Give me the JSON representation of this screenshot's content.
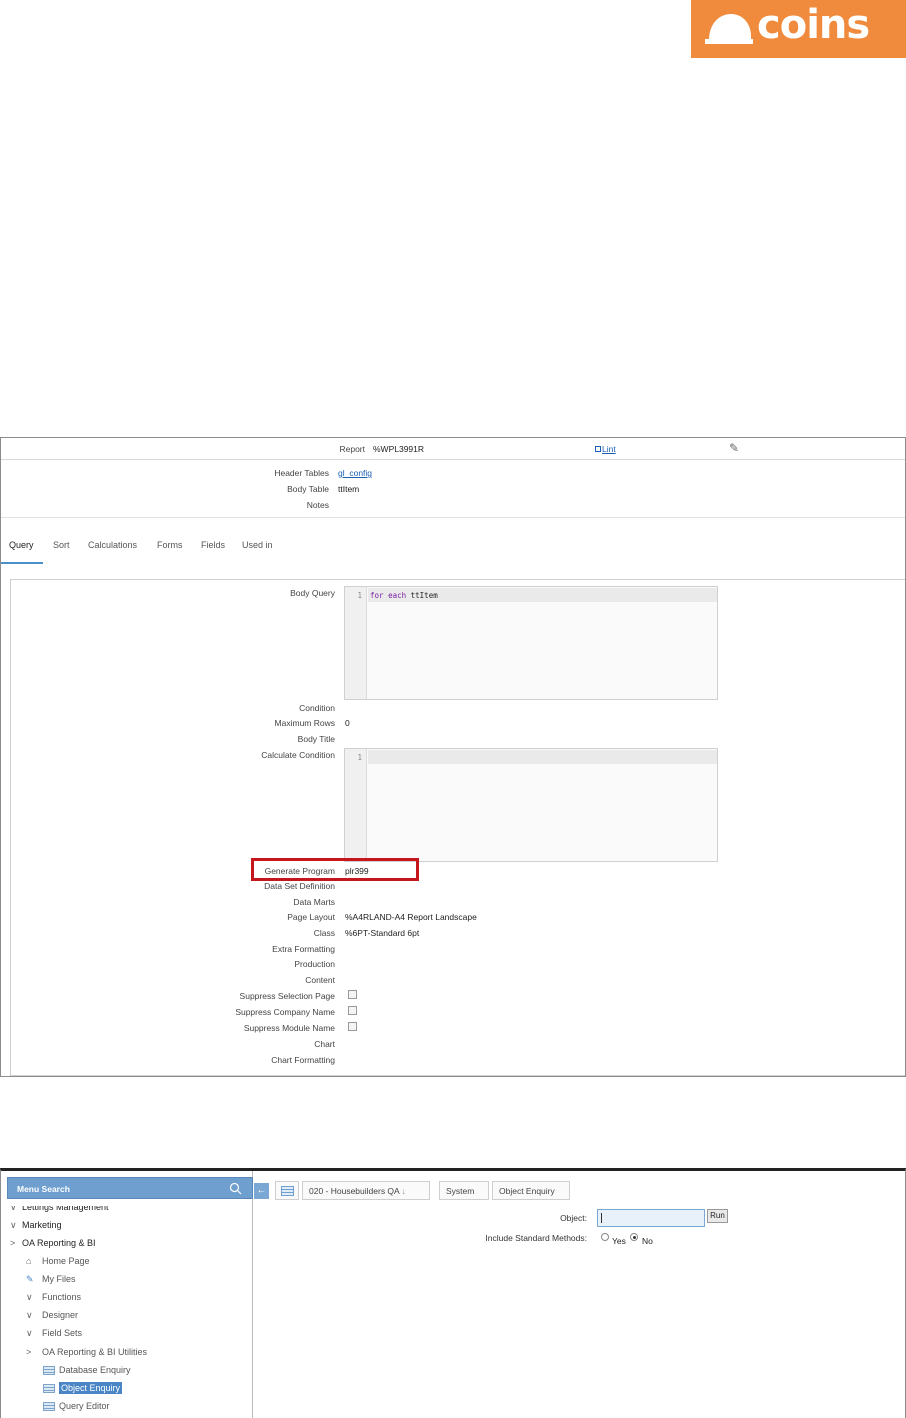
{
  "logo": {
    "text": "coins",
    "color": "#f08a3c"
  },
  "report": {
    "report_label": "Report",
    "report_value": "%WPL3991R",
    "lint_label": "Lint",
    "edit_icon": "pencil-icon",
    "fields": {
      "header_tables_label": "Header Tables",
      "header_tables_value": "gl_config",
      "body_table_label": "Body Table",
      "body_table_value": "ttItem",
      "notes_label": "Notes"
    },
    "tabs": [
      "Query",
      "Sort",
      "Calculations",
      "Forms",
      "Fields",
      "Used in"
    ],
    "active_tab": "Query",
    "query": {
      "body_query_label": "Body Query",
      "body_query_line_no": "1",
      "body_query_kw1": "for",
      "body_query_kw2": "each",
      "body_query_rest": "ttItem",
      "condition_label": "Condition",
      "max_rows_label": "Maximum Rows",
      "max_rows_value": "0",
      "body_title_label": "Body Title",
      "calc_condition_label": "Calculate Condition",
      "calc_condition_line_no": "1",
      "generate_program_label": "Generate Program",
      "generate_program_value": "plr399",
      "data_set_definition_label": "Data Set Definition",
      "data_marts_label": "Data Marts",
      "page_layout_label": "Page Layout",
      "page_layout_value": "%A4RLAND-A4 Report Landscape",
      "class_label": "Class",
      "class_value": "%6PT-Standard 6pt",
      "extra_formatting_label": "Extra Formatting",
      "production_label": "Production",
      "content_label": "Content",
      "suppress_selection_page_label": "Suppress Selection Page",
      "suppress_company_name_label": "Suppress Company Name",
      "suppress_module_name_label": "Suppress Module Name",
      "chart_label": "Chart",
      "chart_formatting_label": "Chart Formatting"
    }
  },
  "enquiry": {
    "menu_search_label": "Menu Search",
    "sidebar": {
      "lettings": "Lettings Management",
      "marketing": "Marketing",
      "oa_reporting": "OA Reporting & BI",
      "home_page": "Home Page",
      "my_files": "My Files",
      "functions": "Functions",
      "designer": "Designer",
      "field_sets": "Field Sets",
      "oa_utils": "OA Reporting & BI Utilities",
      "database_enquiry": "Database Enquiry",
      "object_enquiry": "Object Enquiry",
      "query_editor": "Query Editor"
    },
    "breadcrumb": {
      "company": "020 - Housebuilders QA",
      "system": "System",
      "page": "Object Enquiry"
    },
    "form": {
      "object_label": "Object:",
      "object_value": "",
      "run_label": "Run",
      "include_methods_label": "Include Standard Methods:",
      "yes_label": "Yes",
      "no_label": "No",
      "selected": "No"
    }
  }
}
